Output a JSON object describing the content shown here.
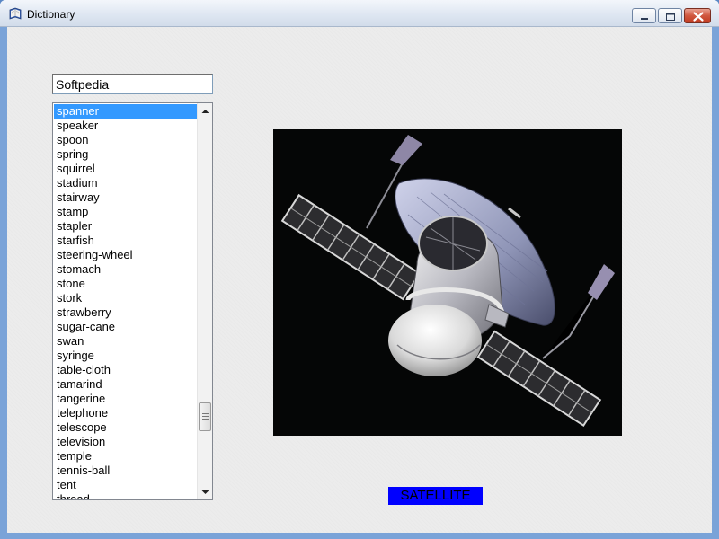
{
  "window": {
    "title": "Dictionary",
    "minimize_label": "",
    "maximize_label": "",
    "close_label": ""
  },
  "search": {
    "value": "Softpedia"
  },
  "word_list": {
    "selected": "spanner",
    "items": [
      "spanner",
      "speaker",
      "spoon",
      "spring",
      "squirrel",
      "stadium",
      "stairway",
      "stamp",
      "stapler",
      "starfish",
      "steering-wheel",
      "stomach",
      "stone",
      "stork",
      "strawberry",
      "sugar-cane",
      "swan",
      "syringe",
      "table-cloth",
      "tamarind",
      "tangerine",
      "telephone",
      "telescope",
      "television",
      "temple",
      "tennis-ball",
      "tent",
      "thread"
    ]
  },
  "picture": {
    "subject": "satellite"
  },
  "caption": {
    "text": "SATELLITE"
  },
  "colors": {
    "selection": "#3399ff",
    "caption_background": "#0000ff",
    "picture_background": "#050606",
    "close_button": "#c84a30"
  },
  "icons": [
    "book-icon",
    "minimize-icon",
    "maximize-icon",
    "close-icon",
    "scroll-up-icon",
    "scroll-down-icon"
  ]
}
